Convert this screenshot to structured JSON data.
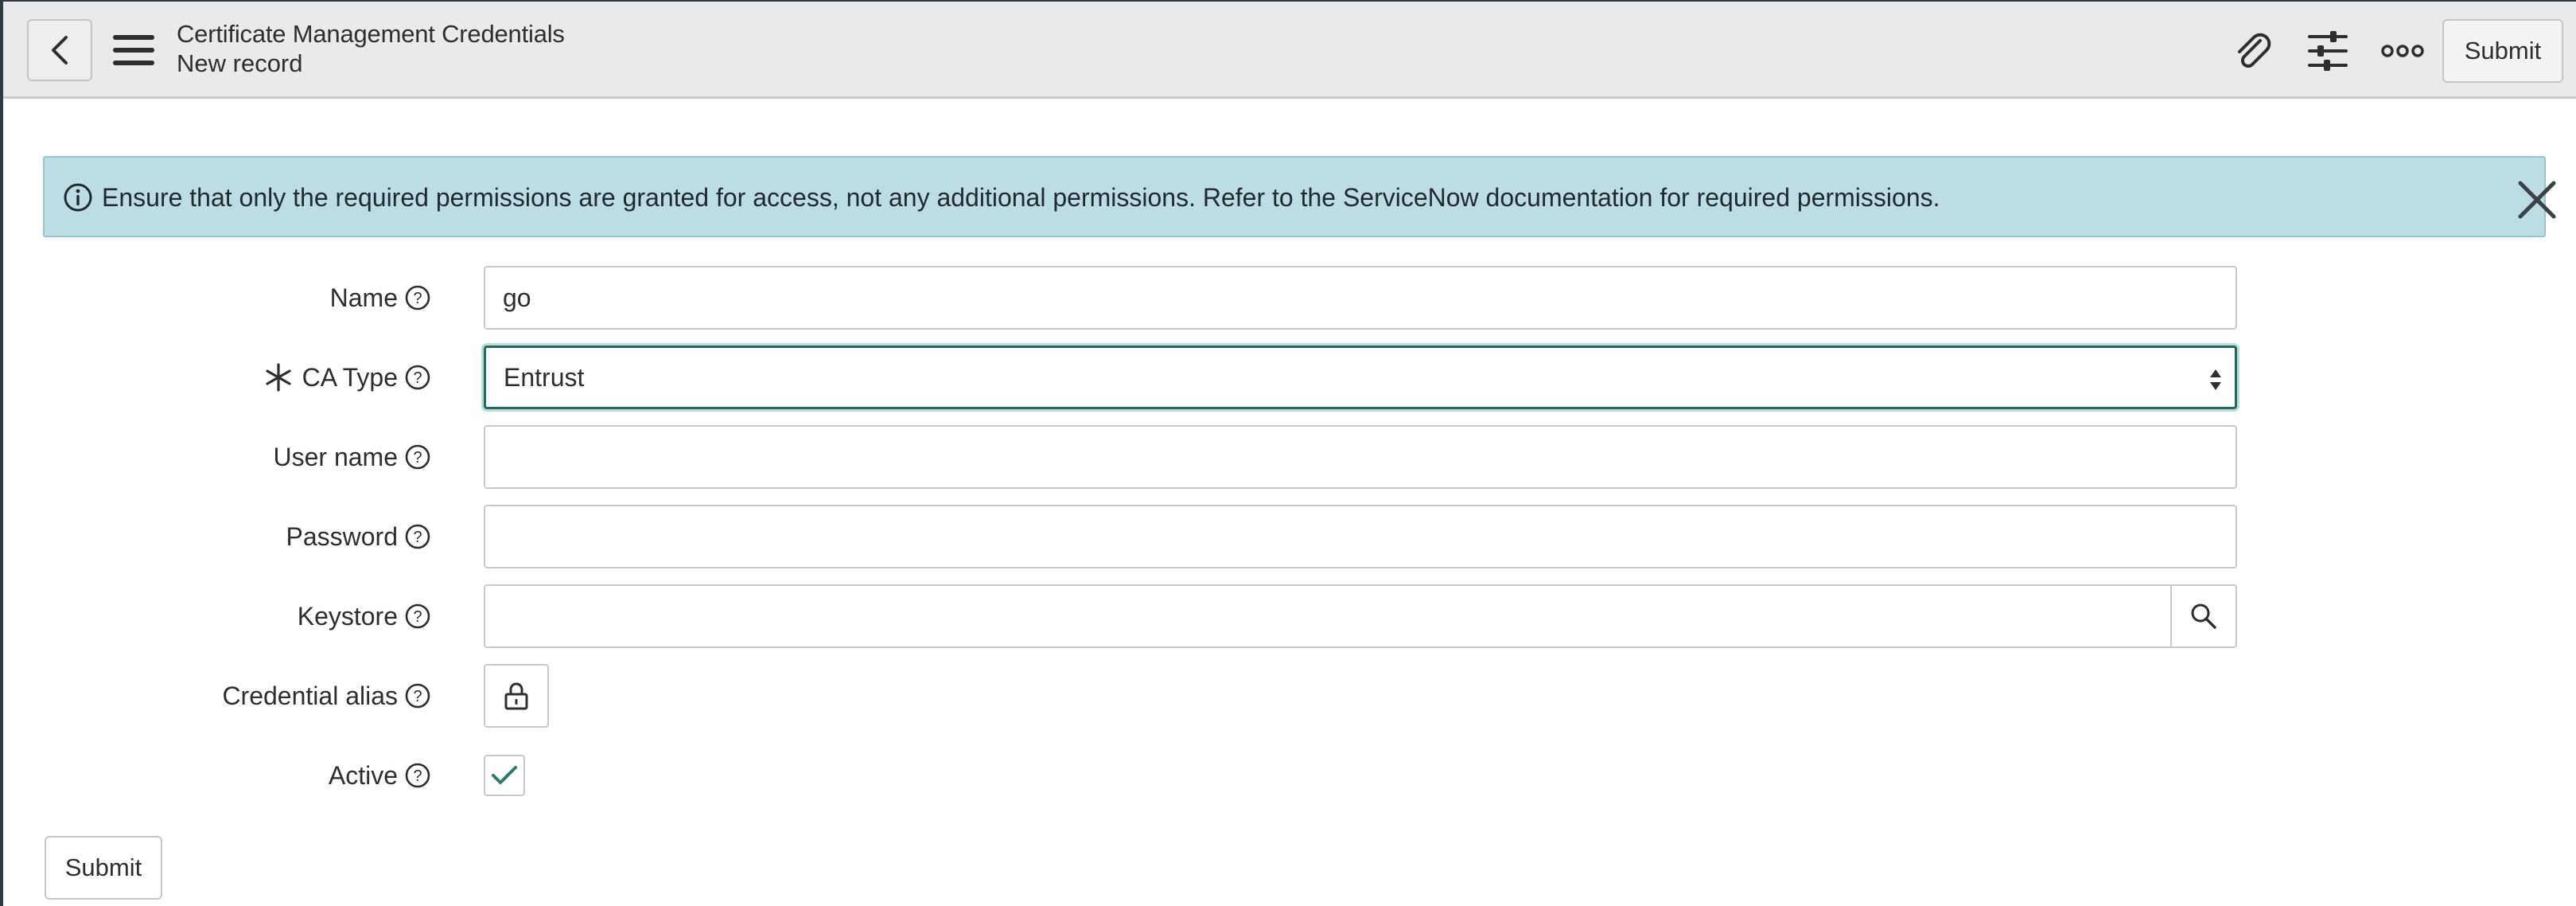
{
  "header": {
    "title": "Certificate Management Credentials",
    "subtitle": "New record",
    "submit_label": "Submit"
  },
  "banner": {
    "message": "Ensure that only the required permissions are granted for access, not any additional permissions. Refer to the ServiceNow documentation for required permissions."
  },
  "form": {
    "name": {
      "label": "Name",
      "value": "go"
    },
    "ca_type": {
      "label": "CA Type",
      "value": "Entrust",
      "required": true
    },
    "user_name": {
      "label": "User name",
      "value": ""
    },
    "password": {
      "label": "Password",
      "value": ""
    },
    "keystore": {
      "label": "Keystore",
      "value": ""
    },
    "credential_alias": {
      "label": "Credential alias"
    },
    "active": {
      "label": "Active",
      "checked": true
    }
  },
  "footer": {
    "submit_label": "Submit"
  },
  "colors": {
    "header_bg": "#e8eaec",
    "banner_bg": "#bcdde3",
    "focus_border": "#1f6b62",
    "check_color": "#2b7a6f"
  },
  "icons": [
    "back-arrow-icon",
    "hamburger-icon",
    "paperclip-icon",
    "sliders-icon",
    "more-options-icon",
    "info-icon",
    "close-icon",
    "help-icon",
    "required-asterisk-icon",
    "select-arrows-icon",
    "search-icon",
    "lock-icon",
    "checkmark-icon"
  ]
}
